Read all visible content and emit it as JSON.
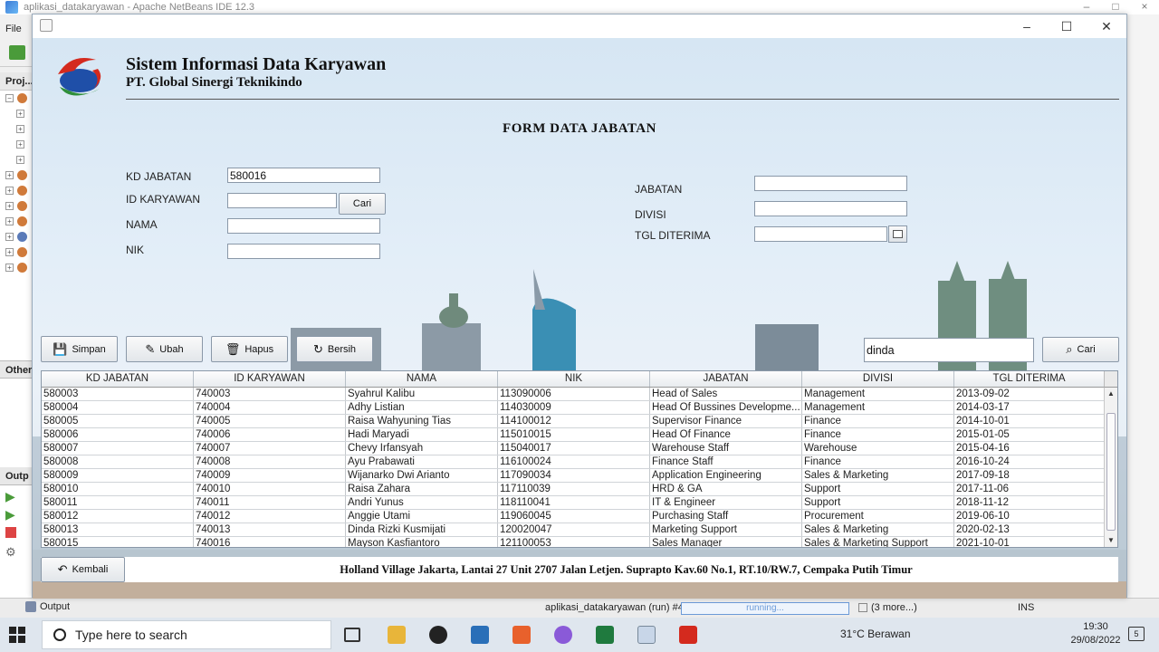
{
  "ide": {
    "title": "aplikasi_datakaryawan - Apache NetBeans IDE 12.3",
    "menu_file": "File",
    "tab_projects": "Proj...",
    "tab_other": "Other",
    "tab_output_short": "Outp",
    "status_output": "Output",
    "status_run": "aplikasi_datakaryawan (run) #4",
    "status_progress": "running...",
    "status_more": "(3 more...)",
    "status_ins": "INS"
  },
  "app": {
    "header_title": "Sistem Informasi Data Karyawan",
    "header_subtitle": "PT. Global Sinergi Teknikindo",
    "form_title": "FORM DATA JABATAN",
    "labels": {
      "kd_jabatan": "KD JABATAN",
      "id_karyawan": "ID KARYAWAN",
      "nama": "NAMA",
      "nik": "NIK",
      "jabatan": "JABATAN",
      "divisi": "DIVISI",
      "tgl_diterima": "TGL DITERIMA"
    },
    "values": {
      "kd_jabatan": "580016",
      "id_karyawan": "",
      "nama": "",
      "nik": "",
      "jabatan": "",
      "divisi": "",
      "tgl_diterima": "",
      "search": "dinda"
    },
    "buttons": {
      "cari_id": "Cari",
      "simpan": "Simpan",
      "ubah": "Ubah",
      "hapus": "Hapus",
      "bersih": "Bersih",
      "cari": "Cari",
      "kembali": "Kembali"
    },
    "table": {
      "columns": [
        "KD JABATAN",
        "ID KARYAWAN",
        "NAMA",
        "NIK",
        "JABATAN",
        "DIVISI",
        "TGL DITERIMA"
      ],
      "rows": [
        [
          "580003",
          "740003",
          "Syahrul Kalibu",
          "113090006",
          "Head of Sales",
          "Management",
          "2013-09-02"
        ],
        [
          "580004",
          "740004",
          "Adhy Listian",
          "114030009",
          "Head Of Bussines Developme...",
          "Management",
          "2014-03-17"
        ],
        [
          "580005",
          "740005",
          "Raisa Wahyuning Tias",
          "114100012",
          "Supervisor Finance",
          "Finance",
          "2014-10-01"
        ],
        [
          "580006",
          "740006",
          "Hadi Maryadi",
          "115010015",
          "Head Of Finance",
          "Finance",
          "2015-01-05"
        ],
        [
          "580007",
          "740007",
          "Chevy Irfansyah",
          "115040017",
          "Warehouse Staff",
          "Warehouse",
          "2015-04-16"
        ],
        [
          "580008",
          "740008",
          "Ayu Prabawati",
          "116100024",
          "Finance Staff",
          "Finance",
          "2016-10-24"
        ],
        [
          "580009",
          "740009",
          "Wijanarko Dwi Arianto",
          "117090034",
          "Application Engineering",
          "Sales & Marketing",
          "2017-09-18"
        ],
        [
          "580010",
          "740010",
          "Raisa Zahara",
          "117110039",
          "HRD & GA",
          "Support",
          "2017-11-06"
        ],
        [
          "580011",
          "740011",
          "Andri Yunus",
          "118110041",
          "IT & Engineer",
          "Support",
          "2018-11-12"
        ],
        [
          "580012",
          "740012",
          "Anggie Utami",
          "119060045",
          "Purchasing Staff",
          "Procurement",
          "2019-06-10"
        ],
        [
          "580013",
          "740013",
          "Dinda Rizki Kusmijati",
          "120020047",
          "Marketing Support",
          "Sales & Marketing",
          "2020-02-13"
        ],
        [
          "580015",
          "740016",
          "Mayson Kasfiantoro",
          "121100053",
          "Sales Manager",
          "Sales & Marketing Support",
          "2021-10-01"
        ]
      ]
    },
    "footer_address": "Holland Village Jakarta, Lantai 27 Unit 2707 Jalan Letjen. Suprapto Kav.60 No.1, RT.10/RW.7, Cempaka Putih Timur"
  },
  "taskbar": {
    "search_placeholder": "Type here to search",
    "weather": "31°C  Berawan",
    "time": "19:30",
    "date": "29/08/2022",
    "notifications": "5"
  },
  "colors": {
    "logo_red": "#d42a1e",
    "logo_blue": "#1f4fa8",
    "logo_green": "#2f8f3a",
    "progress_blue": "#6b9ad8"
  }
}
